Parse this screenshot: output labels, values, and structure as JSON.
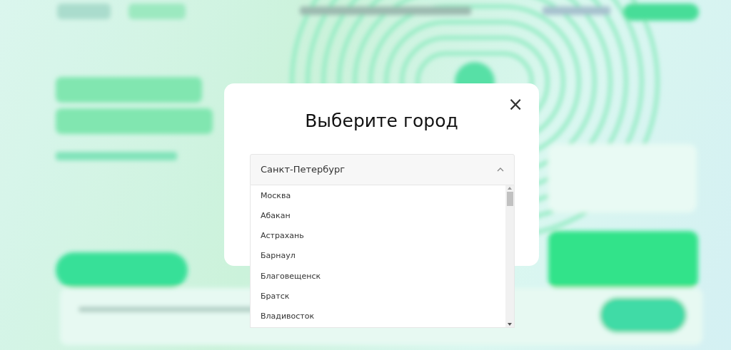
{
  "modal": {
    "title": "Выберите город",
    "close": "×",
    "select": {
      "value": "Санкт-Петербург",
      "expanded": true,
      "options": [
        {
          "label": "Москва"
        },
        {
          "label": "Абакан"
        },
        {
          "label": "Астрахань"
        },
        {
          "label": "Барнаул"
        },
        {
          "label": "Благовещенск"
        },
        {
          "label": "Братск"
        },
        {
          "label": "Владивосток"
        }
      ]
    }
  }
}
